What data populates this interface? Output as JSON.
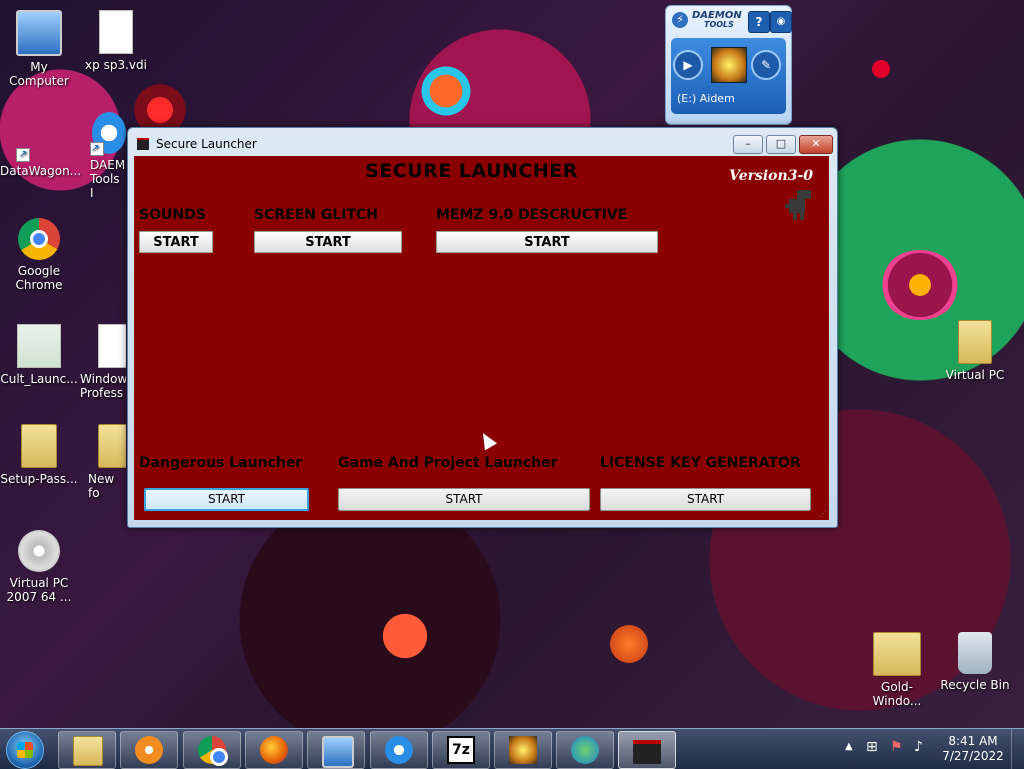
{
  "desktop": {
    "icons_left": [
      {
        "label": "My Computer"
      },
      {
        "label": "xp sp3.vdi"
      },
      {
        "label": "DataWagon..."
      },
      {
        "label": "DAEM Tools I"
      },
      {
        "label": "Google Chrome"
      },
      {
        "label": "Cult_Launc..."
      },
      {
        "label": "Window Profess"
      },
      {
        "label": "Setup-Pass..."
      },
      {
        "label": "New fo"
      },
      {
        "label": "Virtual PC 2007 64 ..."
      }
    ],
    "icons_right": [
      {
        "label": "Virtual PC"
      },
      {
        "label": "Gold-Windo..."
      },
      {
        "label": "Recycle Bin"
      }
    ]
  },
  "daemon_gadget": {
    "brand_line1": "DAEMON",
    "brand_line2": "TOOLS",
    "help_label": "?",
    "rss_label": "◉",
    "drive_label": "(E:) Aidem"
  },
  "window": {
    "title": "Secure Launcher",
    "minimize_label": "–",
    "maximize_label": "□",
    "close_label": "✕",
    "heading": "SECURE LAUNCHER",
    "version": "Version3-0",
    "top_sections": [
      {
        "label": "SOUNDS",
        "button": "START"
      },
      {
        "label": "SCREEN GLITCH",
        "button": "START"
      },
      {
        "label": "MEMZ 9.0 DESCRUCTIVE",
        "button": "START"
      }
    ],
    "bottom_sections": [
      {
        "label": "Dangerous Launcher",
        "button": "START"
      },
      {
        "label": "Game And Project Launcher",
        "button": "START"
      },
      {
        "label": "LICENSE KEY GENERATOR",
        "button": "START"
      }
    ]
  },
  "taskbar": {
    "pinned": [
      "file-explorer-icon",
      "media-player-icon",
      "chrome-icon",
      "firefox-icon",
      "virtual-pc-icon",
      "daemon-tools-icon",
      "7zip-icon",
      "daemon-disk-icon",
      "network-globe-icon",
      "secure-launcher-icon"
    ],
    "sevenzip_label": "7z",
    "clock_time": "8:41 AM",
    "clock_date": "7/27/2022"
  },
  "colors": {
    "launcher_bg": "#8a0000",
    "focus_blue": "#38a4dd"
  }
}
